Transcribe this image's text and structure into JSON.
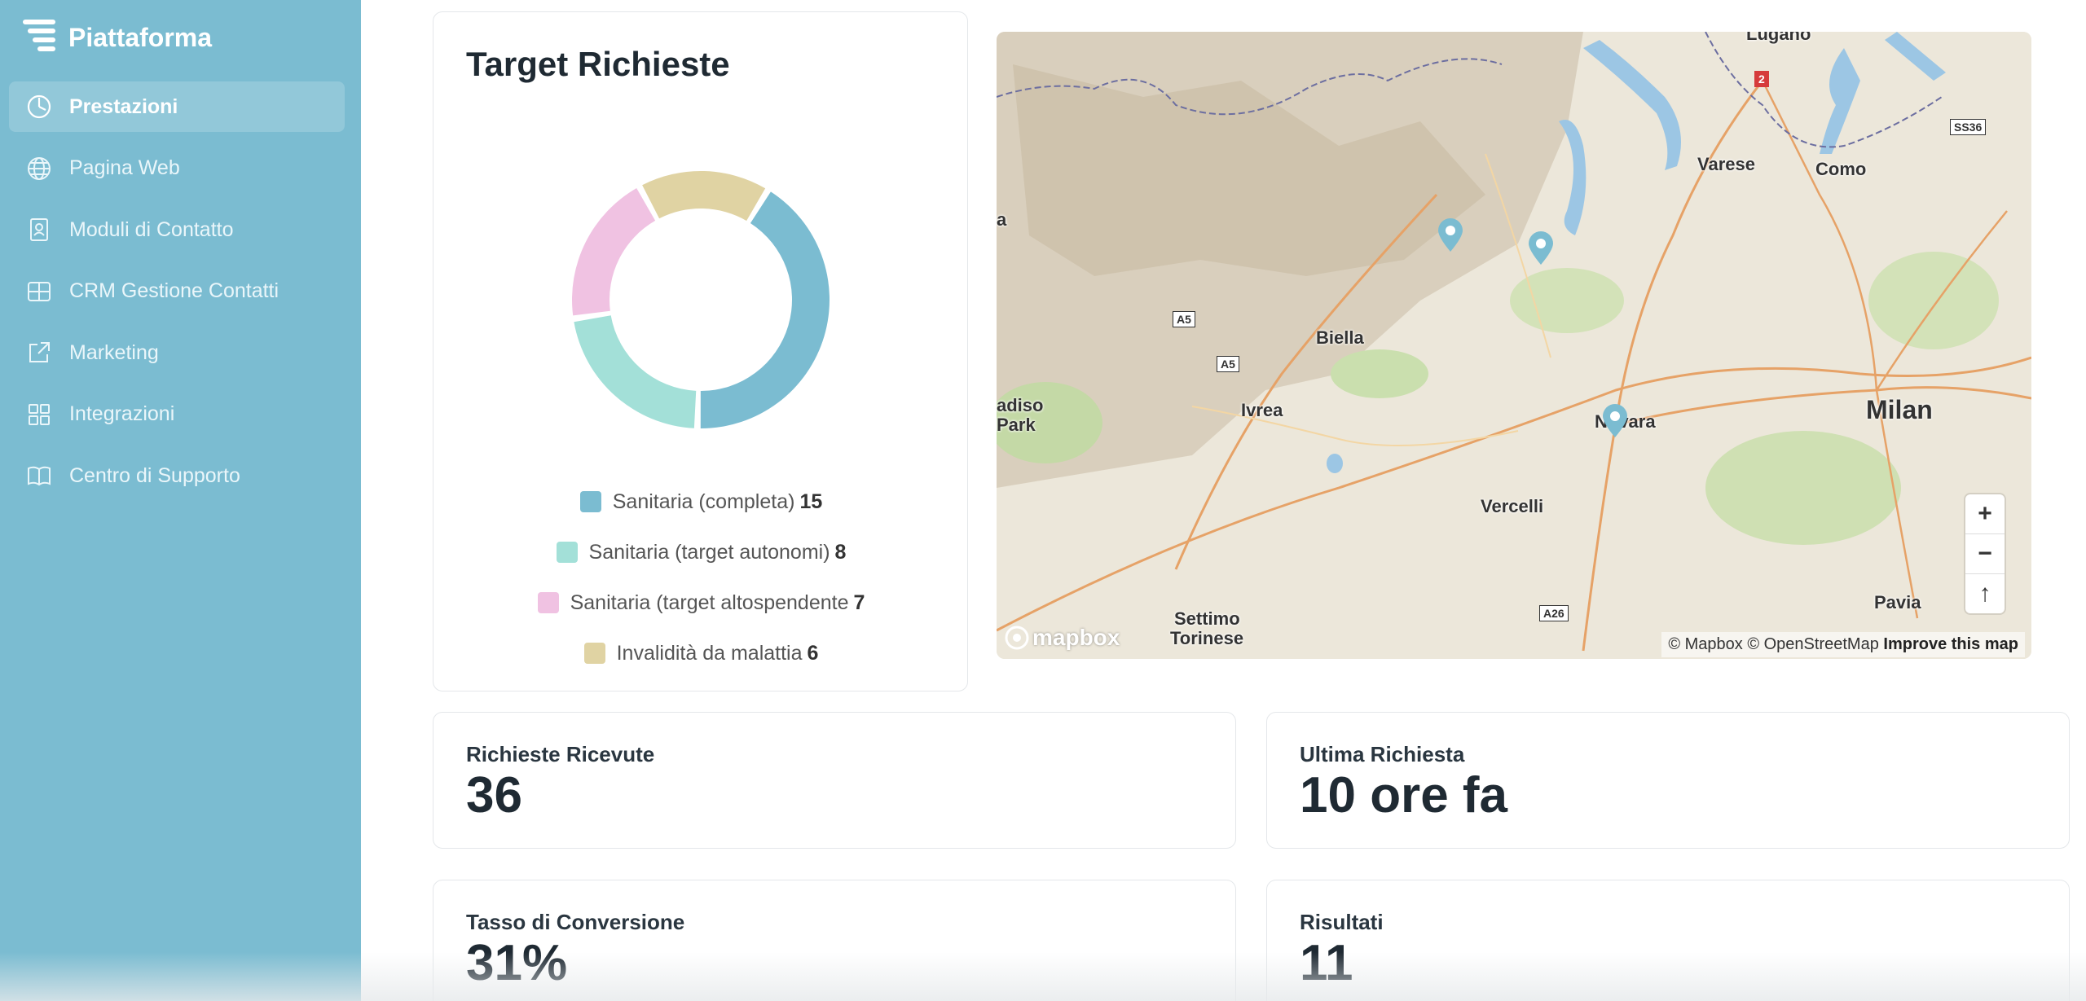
{
  "brand": {
    "name": "Piattaforma"
  },
  "nav": [
    {
      "label": "Prestazioni",
      "icon": "gauge-icon",
      "active": true
    },
    {
      "label": "Pagina Web",
      "icon": "globe-icon",
      "active": false
    },
    {
      "label": "Moduli di Contatto",
      "icon": "contact-form-icon",
      "active": false
    },
    {
      "label": "CRM Gestione Contatti",
      "icon": "crm-icon",
      "active": false
    },
    {
      "label": "Marketing",
      "icon": "share-icon",
      "active": false
    },
    {
      "label": "Integrazioni",
      "icon": "grid-icon",
      "active": false
    },
    {
      "label": "Centro di Supporto",
      "icon": "book-icon",
      "active": false
    }
  ],
  "target": {
    "title": "Target Richieste",
    "legend": [
      {
        "label": "Sanitaria (completa)",
        "value": "15",
        "color": "#7bbcd1"
      },
      {
        "label": "Sanitaria (target autonomi)",
        "value": "8",
        "color": "#a3e0d8"
      },
      {
        "label": "Sanitaria (target altospendente",
        "value": "7",
        "color": "#f0c2e2"
      },
      {
        "label": "Invalidità da malattia",
        "value": "6",
        "color": "#e0d3a3"
      }
    ]
  },
  "chart_data": {
    "type": "pie",
    "donut": true,
    "categories": [
      "Sanitaria (completa)",
      "Sanitaria (target autonomi)",
      "Sanitaria (target altospendente",
      "Invalidità da malattia"
    ],
    "values": [
      15,
      8,
      7,
      6
    ],
    "colors": [
      "#7bbcd1",
      "#a3e0d8",
      "#f0c2e2",
      "#e0d3a3"
    ],
    "title": "Target Richieste",
    "legend": "bottom"
  },
  "map": {
    "labels": {
      "lugano": "Lugano",
      "varese": "Varese",
      "como": "Como",
      "biella": "Biella",
      "novara": "Novara",
      "milan": "Milan",
      "ivrea": "Ivrea",
      "vercelli": "Vercelli",
      "settimo": "Settimo",
      "torinese": "Torinese",
      "pavia": "Pavia",
      "parco": "adiso",
      "park": "Park",
      "a": "a"
    },
    "shields": {
      "a5a": "A5",
      "a5b": "A5",
      "a26": "A26",
      "s536": "SS36",
      "r2": "2"
    },
    "zoom_in": "+",
    "zoom_out": "−",
    "compass": "↑",
    "attribution": "© Mapbox © OpenStreetMap",
    "improve": "Improve this map",
    "logo": "mapbox"
  },
  "stats": {
    "received": {
      "label": "Richieste Ricevute",
      "value": "36"
    },
    "last": {
      "label": "Ultima Richiesta",
      "value": "10 ore fa"
    },
    "conversion": {
      "label": "Tasso di Conversione",
      "value": "31%"
    },
    "results": {
      "label": "Risultati",
      "value": "11"
    }
  }
}
